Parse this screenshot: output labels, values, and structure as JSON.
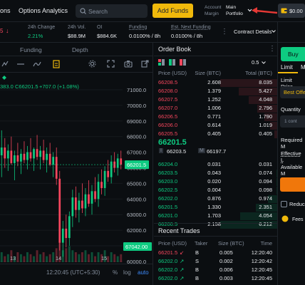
{
  "topbar": {
    "nav_options": "ons",
    "nav_options_analytics": "Options Analytics",
    "search_placeholder": "Search",
    "add_funds": "Add Funds",
    "account_label": "Account",
    "margin_label": "Margin",
    "account_value_1": "Main",
    "account_value_2": "Portfolio",
    "wallet_balance": "$0.00"
  },
  "ticker": {
    "price_change_fragment": "5",
    "change_label": "24h Change",
    "change_value": "2.21%",
    "vol_label": "24h Vol.",
    "vol_value": "$88.9M",
    "oi_label": "OI",
    "oi_value": "$884.6K",
    "funding_label": "Funding",
    "funding_value": "0.0100% / 8h",
    "est_funding_label": "Est. Next Funding",
    "est_funding_value": "0.0100% / 8h",
    "contract_details": "Contract Details"
  },
  "chart": {
    "tabs": [
      "Funding",
      "Depth"
    ],
    "legend_open": "383.0",
    "legend_close": "C66201.5",
    "legend_change": "+707.0 (+1.08%)",
    "price_ticks": [
      "71000.0",
      "70000.0",
      "69000.0",
      "68000.0",
      "67000.0",
      "66000.0",
      "65000.0",
      "64000.0",
      "63000.0",
      "62000.0",
      "61000.0",
      "60000.0"
    ],
    "last_price_tag": "66201.5",
    "bottom_price_tag": "67042.00",
    "date_ticks": [
      "13",
      "14",
      "15"
    ],
    "clock": "12:20:45 (UTC+5:30)",
    "pct": "%",
    "log": "log",
    "auto": "auto"
  },
  "chart_data": {
    "type": "candlestick",
    "x": [
      "13",
      "14",
      "15"
    ],
    "ylim": [
      60000,
      71000
    ],
    "last_price": 66201.5,
    "candles": [
      {
        "o": 66800,
        "h": 68400,
        "l": 65400,
        "c": 67300
      },
      {
        "o": 67300,
        "h": 67900,
        "l": 66000,
        "c": 66600
      },
      {
        "o": 66600,
        "h": 67500,
        "l": 65800,
        "c": 67100
      },
      {
        "o": 67100,
        "h": 68000,
        "l": 66200,
        "c": 66300
      },
      {
        "o": 66300,
        "h": 67100,
        "l": 65200,
        "c": 66800
      },
      {
        "o": 66800,
        "h": 67600,
        "l": 66100,
        "c": 66400
      },
      {
        "o": 66400,
        "h": 67200,
        "l": 65600,
        "c": 66900
      },
      {
        "o": 66900,
        "h": 67700,
        "l": 66300,
        "c": 66500
      },
      {
        "o": 66500,
        "h": 67400,
        "l": 65900,
        "c": 67000
      },
      {
        "o": 67000,
        "h": 67900,
        "l": 66400,
        "c": 66600
      },
      {
        "o": 66600,
        "h": 67300,
        "l": 65800,
        "c": 67200
      },
      {
        "o": 67200,
        "h": 68100,
        "l": 66500,
        "c": 66700
      },
      {
        "o": 66700,
        "h": 67400,
        "l": 65900,
        "c": 67100
      },
      {
        "o": 67100,
        "h": 67800,
        "l": 66300,
        "c": 66500
      },
      {
        "o": 66500,
        "h": 67300,
        "l": 65700,
        "c": 66900
      },
      {
        "o": 66900,
        "h": 67600,
        "l": 66100,
        "c": 66200
      },
      {
        "o": 66200,
        "h": 67000,
        "l": 65400,
        "c": 66700
      },
      {
        "o": 66700,
        "h": 67300,
        "l": 64900,
        "c": 65300
      },
      {
        "o": 65300,
        "h": 65800,
        "l": 60700,
        "c": 61200
      },
      {
        "o": 61200,
        "h": 62600,
        "l": 60300,
        "c": 62100
      },
      {
        "o": 62100,
        "h": 63000,
        "l": 60900,
        "c": 61500
      },
      {
        "o": 61500,
        "h": 63200,
        "l": 61000,
        "c": 62900
      },
      {
        "o": 62900,
        "h": 64600,
        "l": 62200,
        "c": 64100
      },
      {
        "o": 64100,
        "h": 64800,
        "l": 62800,
        "c": 63300
      },
      {
        "o": 63300,
        "h": 64400,
        "l": 62500,
        "c": 63900
      },
      {
        "o": 63900,
        "h": 65000,
        "l": 63100,
        "c": 63400
      },
      {
        "o": 63400,
        "h": 64700,
        "l": 62900,
        "c": 64300
      },
      {
        "o": 64300,
        "h": 65200,
        "l": 63500,
        "c": 63700
      },
      {
        "o": 63700,
        "h": 64900,
        "l": 63000,
        "c": 64500
      },
      {
        "o": 64500,
        "h": 65400,
        "l": 63800,
        "c": 64000
      },
      {
        "o": 64000,
        "h": 65600,
        "l": 63500,
        "c": 65100
      },
      {
        "o": 65100,
        "h": 65900,
        "l": 64300,
        "c": 64700
      },
      {
        "o": 64700,
        "h": 66100,
        "l": 64200,
        "c": 65800
      },
      {
        "o": 65800,
        "h": 66500,
        "l": 65100,
        "c": 65400
      },
      {
        "o": 65400,
        "h": 66800,
        "l": 65000,
        "c": 66400
      },
      {
        "o": 66400,
        "h": 67000,
        "l": 65700,
        "c": 66000
      },
      {
        "o": 66000,
        "h": 66900,
        "l": 65500,
        "c": 66600
      },
      {
        "o": 66600,
        "h": 67100,
        "l": 65900,
        "c": 66201.5
      }
    ],
    "volumes": [
      0.5,
      0.3,
      0.4,
      0.6,
      0.3,
      0.5,
      0.4,
      0.3,
      0.5,
      0.4,
      0.3,
      0.6,
      0.4,
      0.5,
      0.3,
      0.4,
      0.5,
      0.7,
      1.0,
      0.6,
      0.7,
      0.8,
      0.6,
      0.5,
      0.4,
      0.5,
      0.6,
      0.4,
      0.5,
      0.3,
      0.5,
      0.4,
      0.6,
      0.3,
      0.5,
      0.4,
      0.3,
      0.4
    ]
  },
  "orderbook": {
    "title": "Order Book",
    "tick_size": "0.5",
    "headers": [
      "Price (USD)",
      "Size (BTC)",
      "Total (BTC)"
    ],
    "asks": [
      [
        "66208.5",
        "2.608",
        "8.035"
      ],
      [
        "66208.0",
        "1.379",
        "5.427"
      ],
      [
        "66207.5",
        "1.252",
        "4.048"
      ],
      [
        "66207.0",
        "1.006",
        "2.796"
      ],
      [
        "66206.5",
        "0.771",
        "1.790"
      ],
      [
        "66206.0",
        "0.614",
        "1.019"
      ],
      [
        "66205.5",
        "0.405",
        "0.405"
      ]
    ],
    "last_price": "66201.5",
    "index_label": "I",
    "index_price": "66203.5",
    "mark_label": "M",
    "mark_price": "66197.7",
    "bids": [
      [
        "66204.0",
        "0.031",
        "0.031"
      ],
      [
        "66203.5",
        "0.043",
        "0.074"
      ],
      [
        "66203.0",
        "0.020",
        "0.094"
      ],
      [
        "66202.5",
        "0.004",
        "0.098"
      ],
      [
        "66202.0",
        "0.876",
        "0.974"
      ],
      [
        "66201.5",
        "1.330",
        "2.351"
      ],
      [
        "66201.0",
        "1.703",
        "4.054"
      ],
      [
        "66200.5",
        "2.158",
        "6.212"
      ]
    ]
  },
  "trades": {
    "title": "Recent Trades",
    "headers": [
      "Price (USD)",
      "Taker",
      "Size (BTC)",
      "Time"
    ],
    "rows": [
      [
        "66201.5",
        "B",
        "0.005",
        "12:20:40",
        "down"
      ],
      [
        "66202.0",
        "S",
        "0.002",
        "12:20:42",
        "up"
      ],
      [
        "66202.0",
        "B",
        "0.006",
        "12:20:45",
        "up"
      ],
      [
        "66202.0",
        "B",
        "0.003",
        "12:20:45",
        "up"
      ]
    ]
  },
  "order_form": {
    "buy_label": "Buy",
    "limit_tab": "Limit",
    "market_tab_fragment": "M",
    "limit_price_label": "Limit Price",
    "best_offer": "Best Offe",
    "quantity_label": "Quantity",
    "quantity_placeholder": "1 cont",
    "required_margin": "Required M",
    "effective_leverage": "Effective L",
    "available_margin": "Available M",
    "reduce_only": "Reduce",
    "fees": "Fees"
  },
  "colors": {
    "green": "#0ecb81",
    "red": "#f6465d",
    "accent": "#f0b90b"
  }
}
